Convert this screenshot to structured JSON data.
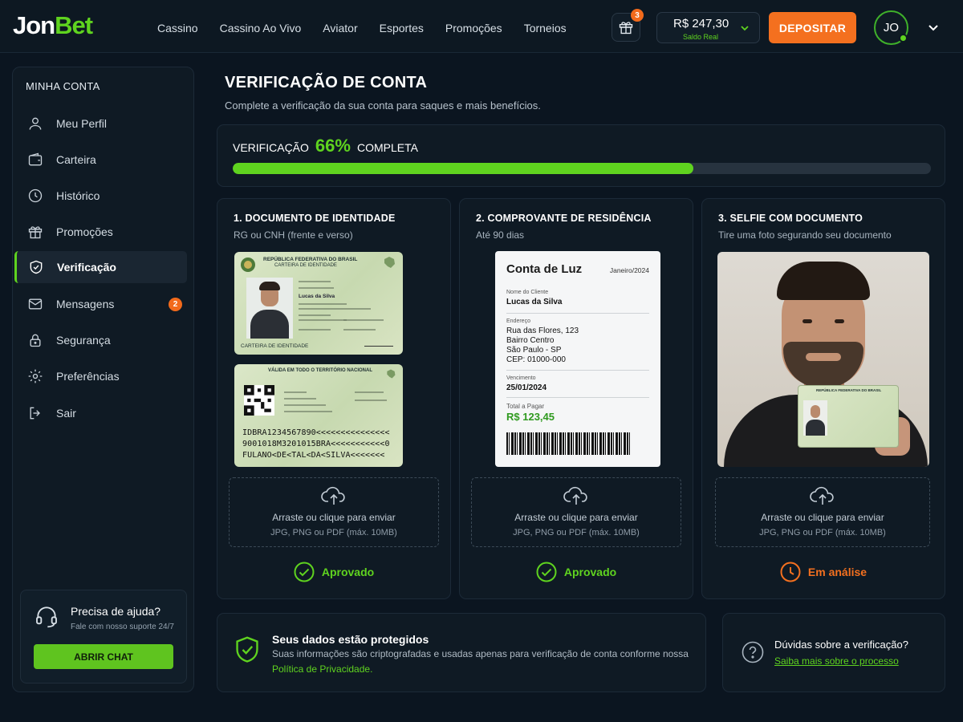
{
  "brand": {
    "logo_part1": "Jon",
    "logo_part2": "Bet",
    "accent": "#5fd31f",
    "orange": "#f4701f"
  },
  "nav": [
    "Cassino",
    "Cassino Ao Vivo",
    "Aviator",
    "Esportes",
    "Promoções",
    "Torneios"
  ],
  "header": {
    "gift_badge": "3",
    "balance_amount": "R$ 247,30",
    "balance_label": "Saldo Real",
    "deposit_label": "DEPOSITAR",
    "avatar_initials": "JO"
  },
  "sidebar": {
    "title": "MINHA CONTA",
    "items": [
      {
        "label": "Meu Perfil",
        "icon": "user-icon"
      },
      {
        "label": "Carteira",
        "icon": "wallet-icon"
      },
      {
        "label": "Histórico",
        "icon": "clock-icon"
      },
      {
        "label": "Promoções",
        "icon": "gift-icon"
      },
      {
        "label": "Verificação",
        "icon": "shield-check-icon",
        "active": true
      },
      {
        "label": "Mensagens",
        "icon": "mail-icon",
        "badge": "2"
      },
      {
        "label": "Segurança",
        "icon": "lock-icon"
      },
      {
        "label": "Preferências",
        "icon": "gear-icon"
      },
      {
        "label": "Sair",
        "icon": "logout-icon"
      }
    ],
    "help": {
      "title": "Precisa de ajuda?",
      "subtitle": "Fale com nosso suporte 24/7",
      "button": "ABRIR CHAT"
    }
  },
  "main": {
    "title": "VERIFICAÇÃO DE CONTA",
    "subtitle": "Complete a verificação da sua conta para saques e mais benefícios.",
    "progress": {
      "prefix": "VERIFICAÇÃO",
      "percent_text": "66%",
      "suffix": "COMPLETA",
      "value": 0.66
    },
    "upload": {
      "line1": "Arraste ou clique para enviar",
      "line2": "JPG, PNG ou PDF (máx. 10MB)"
    },
    "cards": [
      {
        "title": "1. DOCUMENTO DE IDENTIDADE",
        "subtitle": "RG ou CNH (frente e verso)",
        "status": "Aprovado"
      },
      {
        "title": "2. COMPROVANTE DE RESIDÊNCIA",
        "subtitle": "Até 90 dias",
        "status": "Aprovado"
      },
      {
        "title": "3. SELFIE COM DOCUMENTO",
        "subtitle": "Tire uma foto segurando seu documento",
        "status": "Em análise"
      }
    ],
    "id_front": {
      "header1": "REPÚBLICA FEDERATIVA DO BRASIL",
      "header2": "CARTEIRA DE IDENTIDADE",
      "name": "Lucas da Silva",
      "footer": "CARTEIRA DE IDENTIDADE"
    },
    "id_back": {
      "header": "VÁLIDA EM TODO O TERRITÓRIO NACIONAL",
      "mrz1": "IDBRA1234567890<<<<<<<<<<<<<<<",
      "mrz2": "9001018M3201015BRA<<<<<<<<<<<0",
      "mrz3": "FULANO<DE<TAL<DA<SILVA<<<<<<<"
    },
    "bill": {
      "title": "Conta de Luz",
      "date": "Janeiro/2024",
      "client_label": "Nome do Cliente",
      "client": "Lucas da Silva",
      "address_label": "Endereço",
      "address_lines": [
        "Rua das Flores, 123",
        "Bairro Centro",
        "São Paulo - SP",
        "CEP: 01000-000"
      ],
      "due_label": "Vencimento",
      "due": "25/01/2024",
      "total_label": "Total a Pagar",
      "total": "R$ 123,45"
    },
    "selfie_doc_header": "REPÚBLICA FEDERATIVA DO BRASIL"
  },
  "footer_cards": {
    "security_title": "Seus dados estão protegidos",
    "security_text": "Suas informações são criptografadas e usadas apenas para verificação de conta conforme nossa",
    "security_link": "Política de Privacidade.",
    "faq_title": "Dúvidas sobre a verificação?",
    "faq_link": "Saiba mais sobre o processo"
  }
}
